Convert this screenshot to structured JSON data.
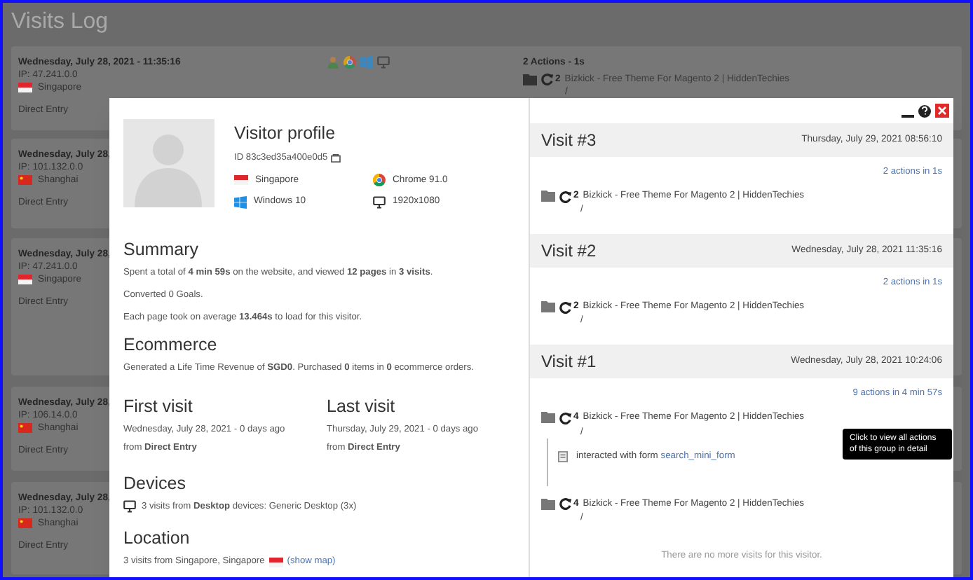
{
  "page_title": "Visits Log",
  "log_cards": [
    {
      "datetime": "Wednesday, July 28, 2021 - 11:35:16",
      "ip": "IP: 47.241.0.0",
      "country": "Singapore",
      "flag": {
        "kind": "sg"
      },
      "referrer": "Direct Entry",
      "visitor_icons": [
        {
          "kind": "profile"
        },
        {
          "kind": "chrome"
        },
        {
          "kind": "windows"
        },
        {
          "kind": "desktop"
        }
      ],
      "actions_summary": "2 Actions - 1s",
      "action": {
        "count": "2",
        "title": "Bizkick - Free Theme For Magento 2 | HiddenTechies",
        "url": "/"
      }
    },
    {
      "datetime": "Wednesday, July 28,",
      "ip": "IP: 101.132.0.0",
      "country": "Shanghai",
      "flag": {
        "kind": "cn"
      },
      "referrer": "Direct Entry"
    },
    {
      "datetime": "Wednesday, July 28,",
      "ip": "IP: 47.241.0.0",
      "country": "Singapore",
      "flag": {
        "kind": "sg"
      },
      "referrer": "Direct Entry"
    },
    {
      "datetime": "Wednesday, July 28,",
      "ip": "IP: 106.14.0.0",
      "country": "Shanghai",
      "flag": {
        "kind": "cn"
      },
      "referrer": "Direct Entry"
    },
    {
      "datetime": "Wednesday, July 28,",
      "ip": "IP: 101.132.0.0",
      "country": "Shanghai",
      "flag": {
        "kind": "cn"
      },
      "referrer": "Direct Entry"
    }
  ],
  "profile": {
    "title": "Visitor profile",
    "id": "ID 83c3ed35a400e0d5",
    "attributes": [
      {
        "kind": "sg",
        "text": "Singapore"
      },
      {
        "kind": "chrome",
        "text": "Chrome 91.0"
      },
      {
        "kind": "windows",
        "text": "Windows 10"
      },
      {
        "kind": "desktop",
        "text": "1920x1080"
      }
    ],
    "summary": {
      "heading": "Summary",
      "lines": [
        "Spent a total of **4 min 59s** on the website, and viewed **12 pages** in **3 visits**.",
        "Converted 0 Goals.",
        "Each page took on average **13.464s** to load for this visitor."
      ]
    },
    "ecommerce": {
      "heading": "Ecommerce",
      "line": "Generated a Life Time Revenue of **SGD0**. Purchased **0** items in **0** ecommerce orders."
    },
    "first_visit": {
      "heading": "First visit",
      "date": "Wednesday, July 28, 2021 - 0 days ago",
      "source": "from **Direct Entry**"
    },
    "last_visit": {
      "heading": "Last visit",
      "date": "Thursday, July 29, 2021 - 0 days ago",
      "source": "from **Direct Entry**"
    },
    "devices": {
      "heading": "Devices",
      "line": "3 visits from **Desktop** devices: Generic Desktop (3x)"
    },
    "location": {
      "heading": "Location",
      "line": "3 visits from Singapore, Singapore",
      "flag": {
        "kind": "sg"
      },
      "link": "(show map)"
    }
  },
  "window_controls": [
    {
      "kind": "minimize"
    },
    {
      "kind": "help"
    },
    {
      "kind": "close"
    }
  ],
  "visits": [
    {
      "title": "Visit #3",
      "date": "Thursday, July 29, 2021 08:56:10",
      "summary": "2 actions in 1s",
      "actions": [
        {
          "count": "2",
          "title": "Bizkick - Free Theme For Magento 2 | HiddenTechies",
          "url": "/"
        }
      ]
    },
    {
      "title": "Visit #2",
      "date": "Wednesday, July 28, 2021 11:35:16",
      "summary": "2 actions in 1s",
      "actions": [
        {
          "count": "2",
          "title": "Bizkick - Free Theme For Magento 2 | HiddenTechies",
          "url": "/"
        }
      ]
    },
    {
      "title": "Visit #1",
      "date": "Wednesday, July 28, 2021 10:24:06",
      "summary": "9 actions in 4 min 57s",
      "actions": [
        {
          "count": "4",
          "title": "Bizkick - Free Theme For Magento 2 | HiddenTechies",
          "url": "/",
          "children": [
            {
              "text": "interacted with form",
              "link": "search_mini_form"
            }
          ]
        },
        {
          "count": "4",
          "title": "Bizkick - Free Theme For Magento 2 | HiddenTechies",
          "url": "/"
        }
      ]
    }
  ],
  "no_more_visits": "There are no more visits for this visitor.",
  "tooltip": "Click to view all actions of this group in detail"
}
